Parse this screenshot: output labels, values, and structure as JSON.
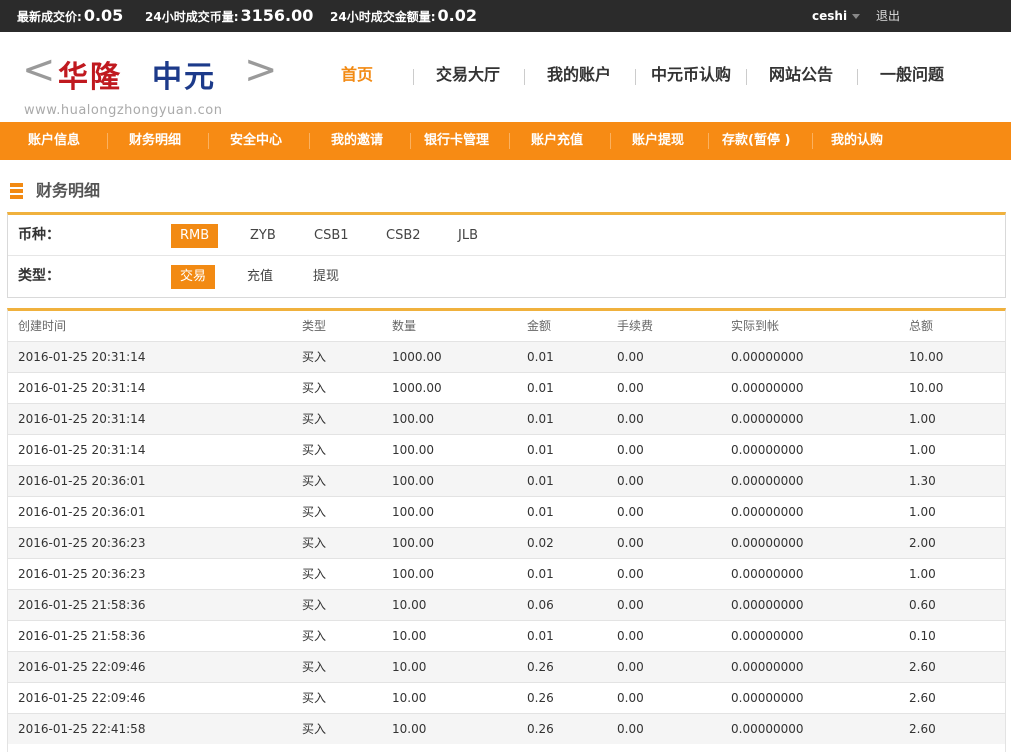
{
  "topbar": {
    "stats": [
      {
        "label": "最新成交价:",
        "value": "0.05"
      },
      {
        "label": "24小时成交币量:",
        "value": "3156.00"
      },
      {
        "label": "24小时成交金额量:",
        "value": "0.02"
      }
    ],
    "username": "ceshi",
    "logout_label": "退出"
  },
  "logo": {
    "left_arrow": "<",
    "right_arrow": ">",
    "name_part1": "华隆",
    "name_part2": "中元",
    "url_text": "www.hualongzhongyuan.con"
  },
  "nav": {
    "items": [
      {
        "label": "首页",
        "active": true
      },
      {
        "label": "交易大厅",
        "active": false
      },
      {
        "label": "我的账户",
        "active": false
      },
      {
        "label": "中元币认购",
        "active": false
      },
      {
        "label": "网站公告",
        "active": false
      },
      {
        "label": "一般问题",
        "active": false
      }
    ]
  },
  "subnav": {
    "items": [
      {
        "label": "账户信息"
      },
      {
        "label": "财务明细"
      },
      {
        "label": "安全中心"
      },
      {
        "label": "我的邀请"
      },
      {
        "label": "银行卡管理"
      },
      {
        "label": "账户充值"
      },
      {
        "label": "账户提现"
      },
      {
        "label": "存款(暂停 )"
      },
      {
        "label": "我的认购"
      }
    ]
  },
  "page": {
    "title": "财务明细"
  },
  "filters": {
    "currency_label": "币种：",
    "currency_options": [
      {
        "label": "RMB",
        "selected": true
      },
      {
        "label": "ZYB",
        "selected": false
      },
      {
        "label": "CSB1",
        "selected": false
      },
      {
        "label": "CSB2",
        "selected": false
      },
      {
        "label": "JLB",
        "selected": false
      }
    ],
    "type_label": "类型：",
    "type_options": [
      {
        "label": "交易",
        "selected": true
      },
      {
        "label": "充值",
        "selected": false
      },
      {
        "label": "提现",
        "selected": false
      }
    ]
  },
  "table": {
    "headers": [
      "创建时间",
      "类型",
      "数量",
      "金额",
      "手续费",
      "实际到帐",
      "总额"
    ],
    "rows": [
      [
        "2016-01-25 20:31:14",
        "买入",
        "1000.00",
        "0.01",
        "0.00",
        "0.00000000",
        "10.00"
      ],
      [
        "2016-01-25 20:31:14",
        "买入",
        "1000.00",
        "0.01",
        "0.00",
        "0.00000000",
        "10.00"
      ],
      [
        "2016-01-25 20:31:14",
        "买入",
        "100.00",
        "0.01",
        "0.00",
        "0.00000000",
        "1.00"
      ],
      [
        "2016-01-25 20:31:14",
        "买入",
        "100.00",
        "0.01",
        "0.00",
        "0.00000000",
        "1.00"
      ],
      [
        "2016-01-25 20:36:01",
        "买入",
        "100.00",
        "0.01",
        "0.00",
        "0.00000000",
        "1.30"
      ],
      [
        "2016-01-25 20:36:01",
        "买入",
        "100.00",
        "0.01",
        "0.00",
        "0.00000000",
        "1.00"
      ],
      [
        "2016-01-25 20:36:23",
        "买入",
        "100.00",
        "0.02",
        "0.00",
        "0.00000000",
        "2.00"
      ],
      [
        "2016-01-25 20:36:23",
        "买入",
        "100.00",
        "0.01",
        "0.00",
        "0.00000000",
        "1.00"
      ],
      [
        "2016-01-25 21:58:36",
        "买入",
        "10.00",
        "0.06",
        "0.00",
        "0.00000000",
        "0.60"
      ],
      [
        "2016-01-25 21:58:36",
        "买入",
        "10.00",
        "0.01",
        "0.00",
        "0.00000000",
        "0.10"
      ],
      [
        "2016-01-25 22:09:46",
        "买入",
        "10.00",
        "0.26",
        "0.00",
        "0.00000000",
        "2.60"
      ],
      [
        "2016-01-25 22:09:46",
        "买入",
        "10.00",
        "0.26",
        "0.00",
        "0.00000000",
        "2.60"
      ],
      [
        "2016-01-25 22:41:58",
        "买入",
        "10.00",
        "0.26",
        "0.00",
        "0.00000000",
        "2.60"
      ]
    ]
  },
  "colors": {
    "accent_orange": "#f78b14",
    "nav_active": "#f28a13",
    "top_bar": "#2b2b2b",
    "logo_red": "#c0191f",
    "logo_blue": "#1c3a8a"
  }
}
